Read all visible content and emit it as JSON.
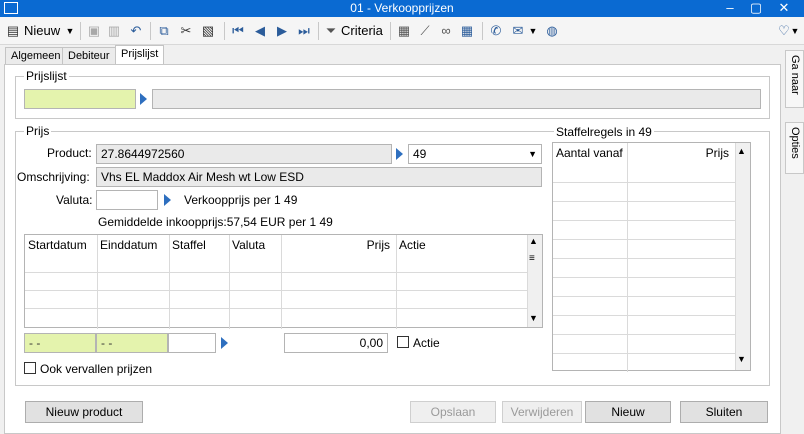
{
  "window": {
    "title": "01 - Verkoopprijzen"
  },
  "toolbar": {
    "new_label": "Nieuw",
    "criteria_label": "Criteria"
  },
  "tabs": [
    "Algemeen",
    "Debiteur",
    "Prijslijst"
  ],
  "side_tabs": [
    "Ga naar",
    "Opties"
  ],
  "prijslijst": {
    "label": "Prijslijst",
    "code": "",
    "description": ""
  },
  "prijs": {
    "label": "Prijs",
    "product_label": "Product:",
    "product_value": "27.8644972560",
    "unit_value": "49",
    "omschrijving_label": "Omschrijving:",
    "omschrijving_value": "Vhs EL Maddox Air Mesh wt Low ESD",
    "valuta_label": "Valuta:",
    "valuta_value": "",
    "verkoopprijs_text": "Verkoopprijs per 1 49",
    "gem_text": "Gemiddelde inkoopprijs:57,54 EUR per 1 49"
  },
  "grid": {
    "columns": [
      "Startdatum",
      "Einddatum",
      "Staffel",
      "Valuta",
      "Prijs",
      "Actie"
    ],
    "rows": []
  },
  "entry": {
    "start": "- -",
    "end": "- -",
    "staffel": "",
    "prijs": "0,00",
    "actie_label": "Actie"
  },
  "ook_vervallen_label": "Ook vervallen prijzen",
  "staffel": {
    "title": "Staffelregels in 49",
    "col_aantal": "Aantal vanaf",
    "col_prijs": "Prijs"
  },
  "buttons": {
    "nieuw_product": "Nieuw product",
    "opslaan": "Opslaan",
    "verwijderen": "Verwijderen",
    "nieuw": "Nieuw",
    "sluiten": "Sluiten"
  },
  "colors": {
    "titlebar": "#0a6ad2",
    "input_yellow": "#e4f3ad",
    "accent_arrow": "#2e6fbf"
  }
}
